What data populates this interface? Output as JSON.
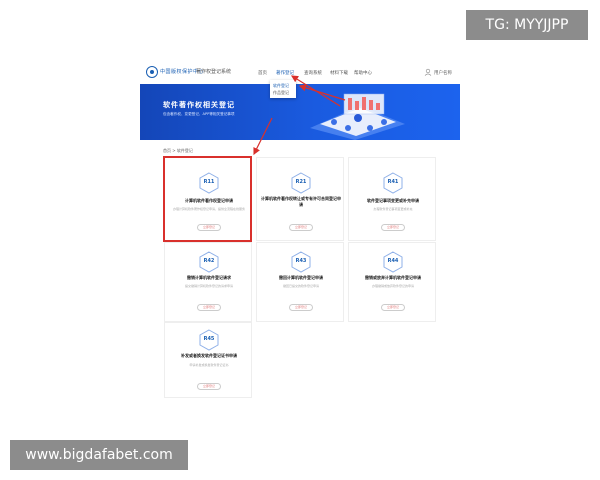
{
  "watermarks": {
    "top_right": "TG: MYYJJPP",
    "bottom_left": "www.bigdafabet.com"
  },
  "header": {
    "logo_text": "中国版权保护中心",
    "logo_sub": "著作权登记系统",
    "nav": [
      {
        "label": "首页"
      },
      {
        "label": "著作登记"
      },
      {
        "label": "查询系统"
      },
      {
        "label": "材料下载"
      },
      {
        "label": "帮助中心"
      }
    ],
    "user_label": "用户名称"
  },
  "dropdown": {
    "items": [
      {
        "label": "软件登记"
      },
      {
        "label": "作品登记"
      }
    ]
  },
  "banner": {
    "title": "软件著作权相关登记",
    "subtitle": "包含著作权、变更登记、APP等相关登记事项"
  },
  "breadcrumb": "首页 > 软件登记",
  "cards": [
    {
      "code": "R11",
      "title": "计算机软件著作权登记申请",
      "desc": "办理计算机软件著作权登记申请，提供全流程在线服务",
      "button": "立即登记"
    },
    {
      "code": "R21",
      "title": "计算机软件著作权转让或专有许可合同登记申请",
      "desc": "",
      "button": "立即登记"
    },
    {
      "code": "R41",
      "title": "软件登记事项变更或补充申请",
      "desc": "办理软件登记事项变更或补充",
      "button": "立即登记"
    },
    {
      "code": "R42",
      "title": "撤销计算机软件登记请求",
      "desc": "提交撤销计算机软件登记的请求申请",
      "button": "立即登记"
    },
    {
      "code": "R43",
      "title": "撤回计算机软件登记申请",
      "desc": "撤回已提交的软件登记申请",
      "button": "立即登记"
    },
    {
      "code": "R44",
      "title": "撤销或放弃计算机软件登记申请",
      "desc": "办理撤销或放弃软件登记的申请",
      "button": "立即登记"
    },
    {
      "code": "R45",
      "title": "补发或者换发软件登记证书申请",
      "desc": "申请补发或换发软件登记证书",
      "button": "立即登记"
    }
  ],
  "colors": {
    "brand_blue": "#1a5be0",
    "highlight_red": "#d9302c"
  }
}
